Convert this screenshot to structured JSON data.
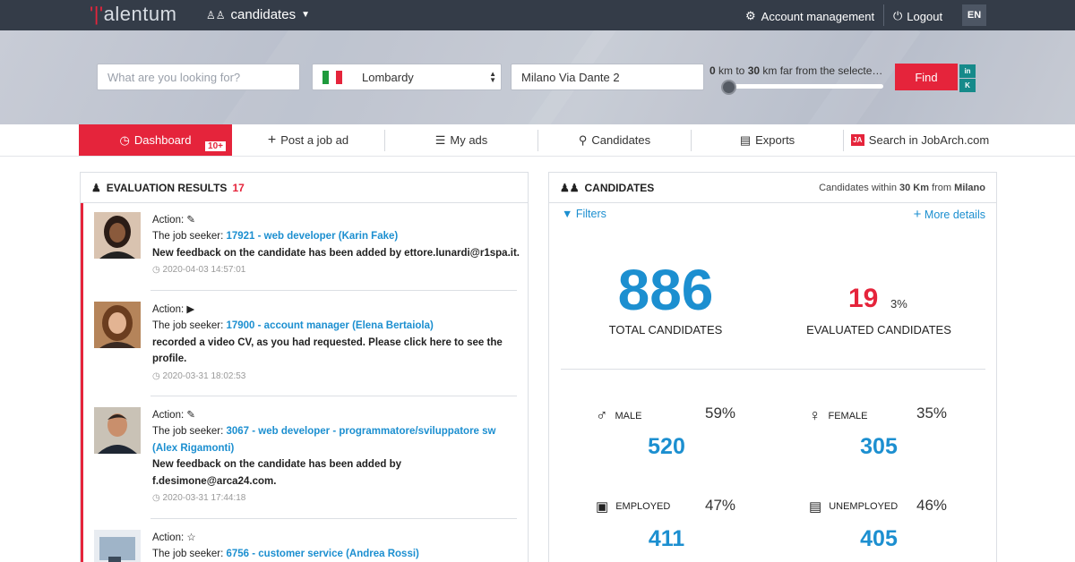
{
  "colors": {
    "accent": "#e5243b",
    "link": "#1c8fd0",
    "topbar": "#343c48"
  },
  "header": {
    "logo_mark": "'|'",
    "logo_text": "alentum",
    "section": "candidates",
    "account_label": "Account management",
    "logout_label": "Logout",
    "lang": "EN"
  },
  "search": {
    "query_placeholder": "What are you looking for?",
    "region": "Lombardy",
    "address": "Milano Via Dante 2",
    "km_min": "0",
    "km_max": "30",
    "km_text_mid": " km to ",
    "km_text_end": " km far from the selecte…",
    "slider_level": 0.0,
    "find_label": "Find",
    "social_top": "in",
    "social_bottom": "K"
  },
  "nav": {
    "dashboard": "Dashboard",
    "dashboard_badge": "10+",
    "post": "Post a job ad",
    "myads": "My ads",
    "candidates": "Candidates",
    "exports": "Exports",
    "jobarch": "Search in JobArch.com",
    "jobarch_logo": "JA"
  },
  "evaluation": {
    "title": "EVALUATION RESULTS",
    "count": "17",
    "items": [
      {
        "action_label": "Action:",
        "seeker_label": "The job seeker:",
        "link": "17921 - web developer (Karin Fake)",
        "message": "New feedback on the candidate has been added by ettore.lunardi@r1spa.it.",
        "time": "2020-04-03 14:57:01"
      },
      {
        "action_label": "Action:",
        "seeker_label": "The job seeker:",
        "link": "17900 - account manager (Elena Bertaiola)",
        "message": "recorded a video CV, as you had requested. Please click here to see the profile.",
        "time": "2020-03-31 18:02:53"
      },
      {
        "action_label": "Action:",
        "seeker_label": "The job seeker:",
        "link": "3067 - web developer - programmatore/sviluppatore sw (Alex Rigamonti)",
        "message": "New feedback on the candidate has been added by f.desimone@arca24.com.",
        "time": "2020-03-31 17:44:18"
      },
      {
        "action_label": "Action:",
        "seeker_label": "The job seeker:",
        "link": "6756 - customer service (Andrea Rossi)",
        "message": "",
        "time": ""
      }
    ]
  },
  "candidates": {
    "title": "CANDIDATES",
    "within_prefix": "Candidates within ",
    "within_km": "30 Km",
    "within_from": " from ",
    "within_city": "Milano",
    "filters": "Filters",
    "more": "More details",
    "total": "886",
    "total_label": "TOTAL CANDIDATES",
    "evaluated": "19",
    "evaluated_pct": "3%",
    "evaluated_label": "EVALUATED CANDIDATES",
    "stats": [
      {
        "label": "MALE",
        "pct": "59%",
        "value": "520",
        "icon": "male-icon"
      },
      {
        "label": "FEMALE",
        "pct": "35%",
        "value": "305",
        "icon": "female-icon"
      },
      {
        "label": "EMPLOYED",
        "pct": "47%",
        "value": "411",
        "icon": "employed-icon"
      },
      {
        "label": "UNEMPLOYED",
        "pct": "46%",
        "value": "405",
        "icon": "unemployed-icon"
      }
    ]
  }
}
